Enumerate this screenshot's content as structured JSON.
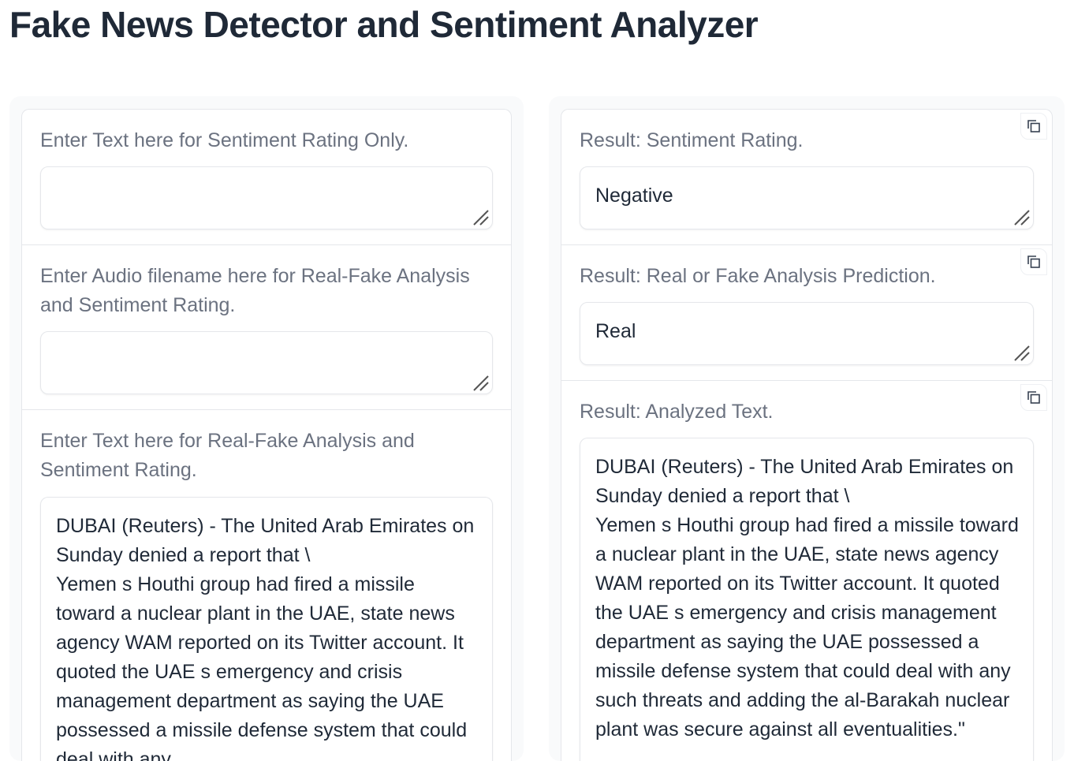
{
  "app": {
    "title": "Fake News Detector and Sentiment Analyzer"
  },
  "inputs": {
    "sentiment_text": {
      "label": "Enter Text here for Sentiment Rating Only.",
      "value": ""
    },
    "audio_filename": {
      "label": "Enter Audio filename here for Real-Fake Analysis and Sentiment Rating.",
      "value": ""
    },
    "analysis_text": {
      "label": "Enter Text here for Real-Fake Analysis and Sentiment Rating.",
      "value": "DUBAI (Reuters) - The United Arab Emirates on Sunday denied a report that \\\nYemen s Houthi group had fired a missile toward a nuclear plant in the UAE, state news agency WAM reported on its Twitter account. It quoted the UAE s emergency and crisis management department as saying the UAE possessed a missile defense system that could deal with any"
    }
  },
  "outputs": {
    "sentiment": {
      "label": "Result: Sentiment Rating.",
      "value": "Negative",
      "icon": "copy-icon"
    },
    "prediction": {
      "label": "Result: Real or Fake Analysis Prediction.",
      "value": "Real",
      "icon": "copy-icon"
    },
    "analyzed_text": {
      "label": "Result: Analyzed Text.",
      "value": "DUBAI (Reuters) - The United Arab Emirates on Sunday denied a report that \\\nYemen s Houthi group had fired a missile toward a nuclear plant in the UAE, state news agency WAM reported on its Twitter account. It quoted the UAE s emergency and crisis management department as saying the UAE possessed a missile defense system that could deal with any such threats and adding the al-Barakah nuclear plant was secure against all eventualities.\"",
      "icon": "copy-icon"
    }
  },
  "colors": {
    "title": "#1f2937",
    "label": "#6b7280",
    "border": "#e5e7eb",
    "column_bg": "#f9fafb"
  }
}
